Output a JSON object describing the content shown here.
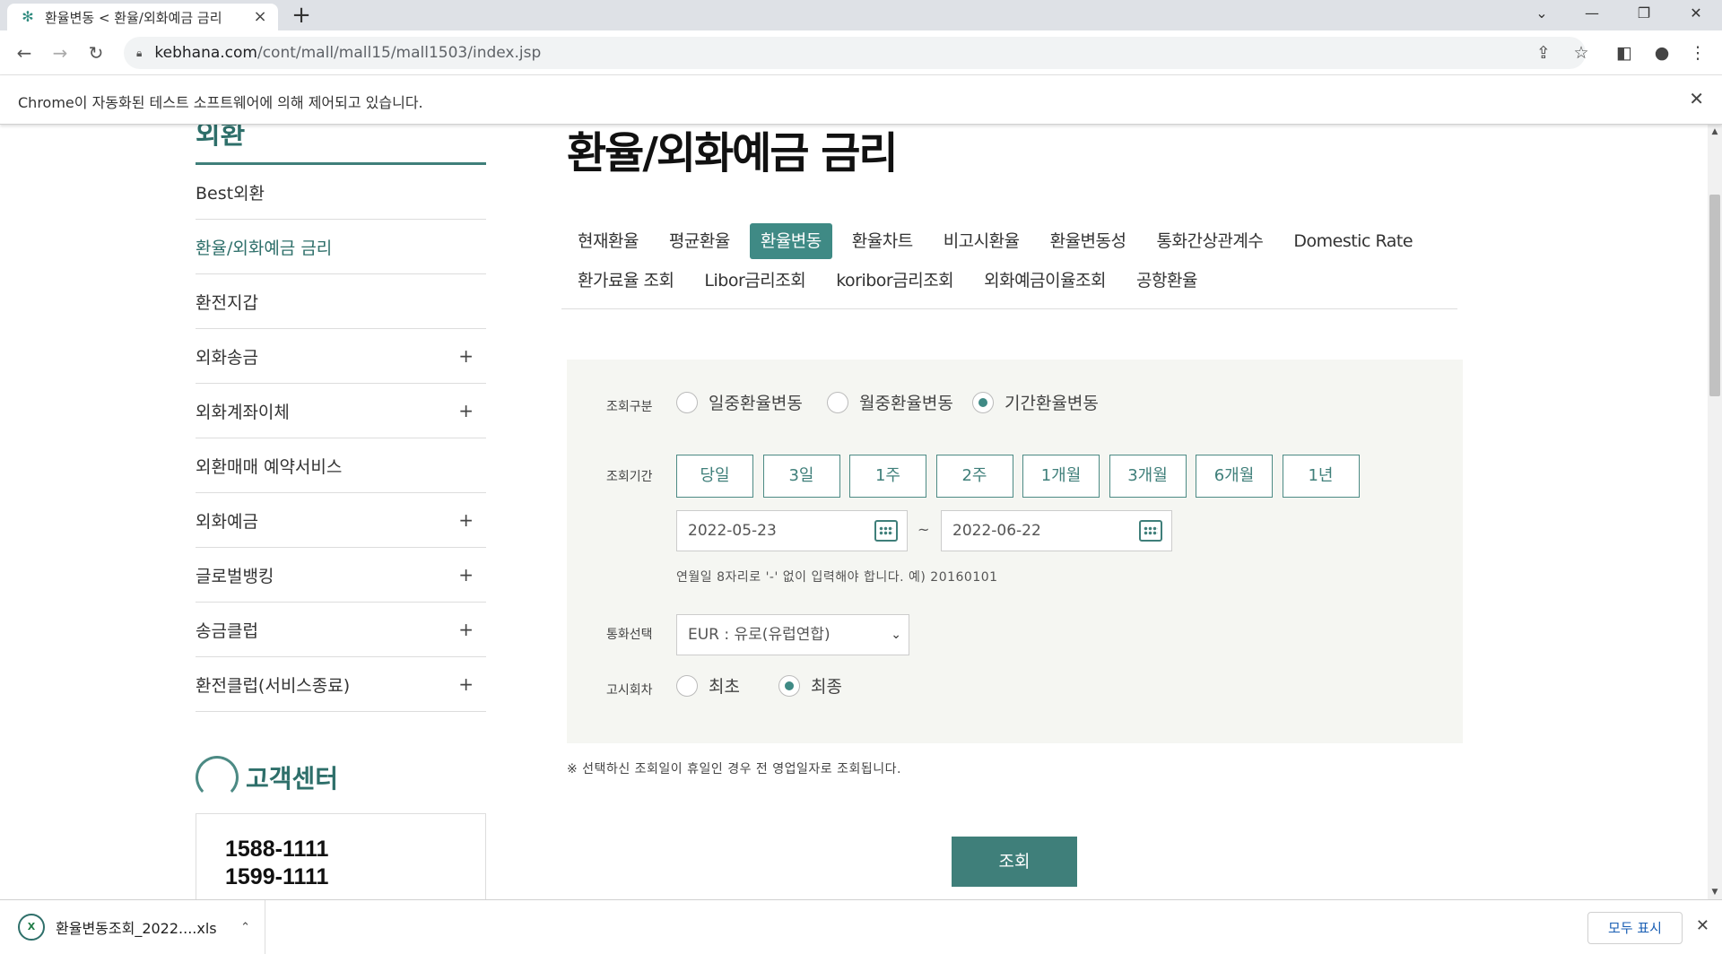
{
  "browser": {
    "tab_title": "환율변동 < 환율/외화예금 금리",
    "url_host": "kebhana.com",
    "url_path": "/cont/mall/mall15/mall1503/index.jsp",
    "infobar_message": "Chrome이 자동화된 테스트 소프트웨어에 의해 제어되고 있습니다."
  },
  "sidebar": {
    "heading": "외환",
    "items": [
      {
        "label": "Best외환",
        "expandable": false
      },
      {
        "label": "환율/외화예금 금리",
        "expandable": false
      },
      {
        "label": "환전지갑",
        "expandable": false
      },
      {
        "label": "외화송금",
        "expandable": true
      },
      {
        "label": "외화계좌이체",
        "expandable": true
      },
      {
        "label": "외환매매 예약서비스",
        "expandable": false
      },
      {
        "label": "외화예금",
        "expandable": true
      },
      {
        "label": "글로벌뱅킹",
        "expandable": true
      },
      {
        "label": "송금클럽",
        "expandable": true
      },
      {
        "label": "환전클럽(서비스종료)",
        "expandable": true
      }
    ],
    "plus_glyph": "+",
    "customer_center": {
      "title": "고객센터",
      "phone1": "1588-1111",
      "phone2": "1599-1111"
    }
  },
  "main": {
    "title": "환율/외화예금 금리",
    "tabs_row1": [
      "현재환율",
      "평균환율",
      "환율변동",
      "환율차트",
      "비고시환율",
      "환율변동성",
      "통화간상관계수",
      "Domestic Rate"
    ],
    "tabs_row2": [
      "환가료율 조회",
      "Libor금리조회",
      "koribor금리조회",
      "외화예금이율조회",
      "공항환율"
    ],
    "active_tab": "환율변동",
    "form": {
      "query_type_label": "조회구분",
      "query_types": [
        {
          "label": "일중환율변동",
          "checked": false
        },
        {
          "label": "월중환율변동",
          "checked": false
        },
        {
          "label": "기간환율변동",
          "checked": true
        }
      ],
      "period_label": "조회기간",
      "period_buttons": [
        "당일",
        "3일",
        "1주",
        "2주",
        "1개월",
        "3개월",
        "6개월",
        "1년"
      ],
      "start_date": "2022-05-23",
      "end_date": "2022-06-22",
      "tilde": "~",
      "date_hint": "연월일 8자리로 '-' 없이 입력해야 합니다. 예) 20160101",
      "currency_label": "통화선택",
      "currency_value": "EUR : 유로(유럽연합)",
      "notice_label": "고시회차",
      "notice_types": [
        {
          "label": "최초",
          "checked": false
        },
        {
          "label": "최종",
          "checked": true
        }
      ]
    },
    "note": "※ 선택하신 조회일이 휴일인 경우 전 영업일자로 조회됩니다.",
    "submit_label": "조회"
  },
  "downloads": {
    "file_name": "환율변동조회_2022....xls",
    "show_all": "모두 표시"
  },
  "colors": {
    "accent": "#3f8a85",
    "accent_dark": "#3f7f7a",
    "form_bg": "#f5f6f2"
  }
}
